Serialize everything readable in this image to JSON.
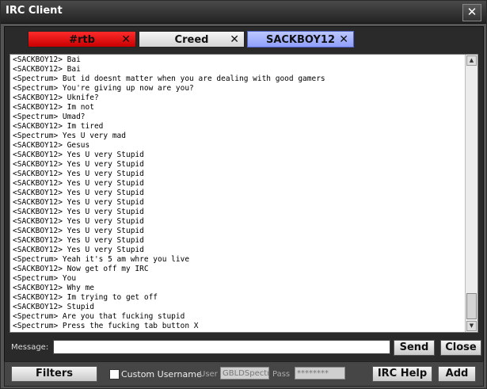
{
  "window": {
    "title": "IRC Client",
    "close_glyph": "✕"
  },
  "tabs": [
    {
      "label": "#rtb",
      "color": "#e80000",
      "close_glyph": "✕"
    },
    {
      "label": "Creed",
      "color": "#e6e6e6",
      "close_glyph": "✕"
    },
    {
      "label": "SACKBOY12",
      "color": "#a6b2ff",
      "close_glyph": "✕",
      "active": true
    }
  ],
  "chat": {
    "lines": [
      "<SACKBOY12> Bai",
      "<SACKBOY12> Bai",
      "<Spectrum> But id doesnt matter when you are dealing with good gamers",
      "<Spectrum> You're giving up now are you?",
      "<SACKBOY12> Uknife?",
      "<SACKBOY12> Im not",
      "<Spectrum> Umad?",
      "<SACKBOY12> Im tired",
      "<Spectrum> Yes U very mad",
      "<SACKBOY12> Gesus",
      "<SACKBOY12> Yes U very Stupid",
      "<SACKBOY12> Yes U very Stupid",
      "<SACKBOY12> Yes U very Stupid",
      "<SACKBOY12> Yes U very Stupid",
      "<SACKBOY12> Yes U very Stupid",
      "<SACKBOY12> Yes U very Stupid",
      "<SACKBOY12> Yes U very Stupid",
      "<SACKBOY12> Yes U very Stupid",
      "<SACKBOY12> Yes U very Stupid",
      "<SACKBOY12> Yes U very Stupid",
      "<SACKBOY12> Yes U very Stupid",
      "<Spectrum> Yeah it's 5 am whre you live",
      "<SACKBOY12> Now get off my IRC",
      "<Spectrum> You",
      "<SACKBOY12> Why me",
      "<SACKBOY12> Im trying to get off",
      "<SACKBOY12> Stupid",
      "<Spectrum> Are you that fucking stupid",
      "<Spectrum> Press the fucking tab button X"
    ],
    "scroll_up_glyph": "▲",
    "scroll_down_glyph": "▼"
  },
  "message": {
    "label": "Message:",
    "value": ""
  },
  "buttons": {
    "send": "Send",
    "close": "Close",
    "filters": "Filters",
    "irc_help": "IRC Help",
    "add": "Add"
  },
  "custom_username": {
    "label": "Custom Username",
    "checked": false
  },
  "user": {
    "label": "User",
    "value": "GBLDSpectr"
  },
  "pass": {
    "label": "Pass",
    "value": "********"
  }
}
